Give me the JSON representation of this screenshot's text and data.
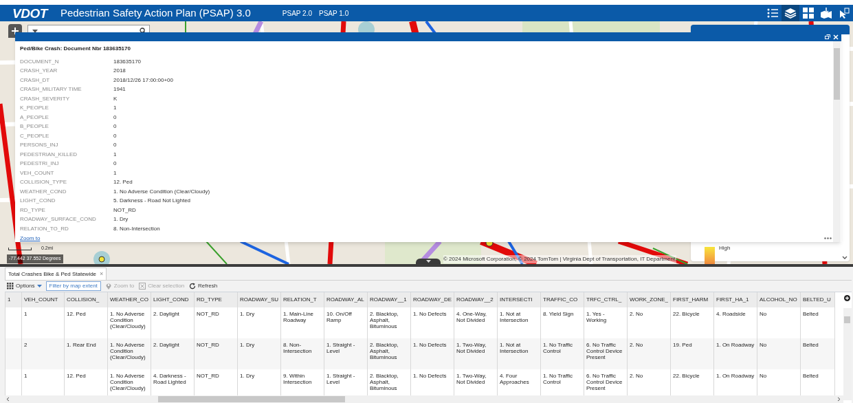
{
  "header": {
    "logo": "VDOT",
    "title": "Pedestrian Safety Action Plan (PSAP) 3.0",
    "links": [
      "PSAP 2.0",
      "PSAP 1.0"
    ],
    "tools": [
      {
        "kind": "list",
        "selected": false
      },
      {
        "kind": "layers",
        "selected": true
      },
      {
        "kind": "grid",
        "selected": false
      },
      {
        "kind": "map",
        "selected": false
      },
      {
        "kind": "cursor",
        "selected": false
      }
    ]
  },
  "popup": {
    "title": "Ped/Bike Crash: Document Nbr 183635170",
    "fields": [
      {
        "label": "DOCUMENT_N",
        "value": "183635170"
      },
      {
        "label": "CRASH_YEAR",
        "value": "2018"
      },
      {
        "label": "CRASH_DT",
        "value": "2018/12/26 17:00:00+00"
      },
      {
        "label": "CRASH_MILITARY TIME",
        "value": "1941"
      },
      {
        "label": "CRASH_SEVERITY",
        "value": "K"
      },
      {
        "label": "K_PEOPLE",
        "value": "1"
      },
      {
        "label": "A_PEOPLE",
        "value": "0"
      },
      {
        "label": "B_PEOPLE",
        "value": "0"
      },
      {
        "label": "C_PEOPLE",
        "value": "0"
      },
      {
        "label": "PERSONS_INJ",
        "value": "0"
      },
      {
        "label": "PEDESTRIAN_KILLED",
        "value": "1"
      },
      {
        "label": "PEDESTRI_INJ",
        "value": "0"
      },
      {
        "label": "VEH_COUNT",
        "value": "1"
      },
      {
        "label": "COLLISION_TYPE",
        "value": "12. Ped"
      },
      {
        "label": "WEATHER_COND",
        "value": "1. No Adverse Condition (Clear/Cloudy)"
      },
      {
        "label": "LIGHT_COND",
        "value": "5. Darkness - Road Not Lighted"
      },
      {
        "label": "RD_TYPE",
        "value": "NOT_RD"
      },
      {
        "label": "ROADWAY_SURFACE_COND",
        "value": "1. Dry"
      },
      {
        "label": "RELATION_TO_RD",
        "value": "8. Non-Intersection"
      }
    ],
    "link": "Zoom to"
  },
  "map": {
    "legend_label": "High",
    "scale": "0.2mi",
    "coordinates": "-77.442 37.552 Degrees",
    "attribution": "© 2024 Microsoft Corporation, © 2024 TomTom | Virginia Dept of Transportation, IT Department,"
  },
  "table": {
    "tabs": [
      {
        "label": "Total Crashes Bike & Ped Statewide",
        "close": "×",
        "selected": true
      }
    ],
    "toolbar": [
      {
        "kind": "options",
        "label": "Options",
        "disabled": false
      },
      {
        "kind": "filter",
        "label": "Filter by map extent",
        "disabled": false
      },
      {
        "kind": "zoom",
        "label": "Zoom to",
        "disabled": true
      },
      {
        "kind": "clear",
        "label": "Clear selection",
        "disabled": true
      },
      {
        "kind": "refresh",
        "label": "Refresh",
        "disabled": false
      }
    ],
    "columns": [
      "1",
      "VEH_COUNT",
      "COLLISION_",
      "WEATHER_CO",
      "LIGHT_COND",
      "RD_TYPE",
      "ROADWAY_SU",
      "RELATION_T",
      "ROADWAY_AL",
      "ROADWAY__1",
      "ROADWAY_DE",
      "ROADWAY__2",
      "INTERSECTI",
      "TRAFFIC_CO",
      "TRFC_CTRL_",
      "WORK_ZONE_",
      "FIRST_HARM",
      "FIRST_HA_1",
      "ALCOHOL_NO",
      "BELTED_U"
    ],
    "rows": [
      {
        "cells": [
          "",
          "1",
          "12. Ped",
          "1. No Adverse Condition (Clear/Cloudy)",
          "2. Daylight",
          "NOT_RD",
          "1. Dry",
          "1. Main-Line Roadway",
          "10. On/Off Ramp",
          "2. Blacktop, Asphalt, Bituminous",
          "1. No Defects",
          "4. One-Way, Not Divided",
          "1. Not at Intersection",
          "8. Yield Sign",
          "1. Yes - Working",
          "2. No",
          "22. Bicycle",
          "4. Roadside",
          "No",
          "Belted"
        ]
      },
      {
        "cells": [
          "",
          "2",
          "1. Rear End",
          "1. No Adverse Condition (Clear/Cloudy)",
          "2. Daylight",
          "NOT_RD",
          "1. Dry",
          "8. Non-Intersection",
          "1. Straight - Level",
          "2. Blacktop, Asphalt, Bituminous",
          "1. No Defects",
          "1. Two-Way, Not Divided",
          "1. Not at Intersection",
          "1. No Traffic Control",
          "6. No Traffic Control Device Present",
          "2. No",
          "19. Ped",
          "1. On Roadway",
          "No",
          "Belted"
        ]
      },
      {
        "cells": [
          "",
          "1",
          "12. Ped",
          "1. No Adverse Condition (Clear/Cloudy)",
          "4. Darkness - Road Lighted",
          "NOT_RD",
          "1. Dry",
          "9. Within Intersection",
          "1. Straight - Level",
          "2. Blacktop, Asphalt, Bituminous",
          "1. No Defects",
          "1. Two-Way, Not Divided",
          "4. Four Approaches",
          "1. No Traffic Control",
          "6. No Traffic Control Device Present",
          "2. No",
          "22. Bicycle",
          "1. On Roadway",
          "No",
          "Belted"
        ]
      }
    ]
  }
}
